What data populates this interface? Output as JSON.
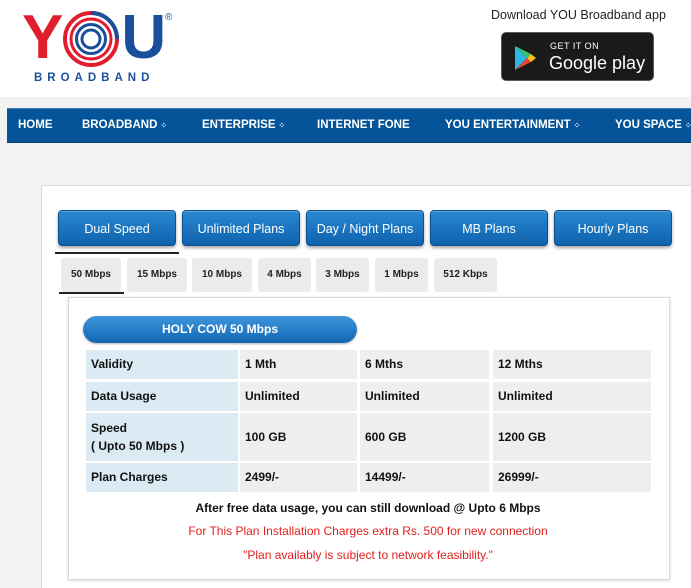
{
  "brand": {
    "logo_text": "YOU",
    "logo_subtitle": "BROADBAND",
    "registered_mark": "®"
  },
  "app_promo": {
    "text": "Download YOU Broadband app",
    "store_small": "GET IT ON",
    "store_big": "Google play"
  },
  "nav": {
    "items": [
      {
        "label": "HOME",
        "dropdown": false
      },
      {
        "label": "BROADBAND",
        "dropdown": true
      },
      {
        "label": "ENTERPRISE",
        "dropdown": true
      },
      {
        "label": "INTERNET FONE",
        "dropdown": false
      },
      {
        "label": "YOU ENTERTAINMENT",
        "dropdown": true
      },
      {
        "label": "YOU SPACE",
        "dropdown": true
      }
    ],
    "dropdown_glyph": "⁘"
  },
  "categories": {
    "items": [
      "Dual Speed",
      "Unlimited Plans",
      "Day / Night Plans",
      "MB Plans",
      "Hourly Plans"
    ],
    "selected": "Dual Speed"
  },
  "speed_tabs": {
    "items": [
      "50 Mbps",
      "15 Mbps",
      "10 Mbps",
      "4 Mbps",
      "3 Mbps",
      "1 Mbps",
      "512 Kbps"
    ],
    "selected": "50 Mbps"
  },
  "plan": {
    "title": "HOLY COW 50 Mbps",
    "table": {
      "rows": [
        {
          "label": "Validity",
          "values": [
            "1 Mth",
            "6 Mths",
            "12 Mths"
          ]
        },
        {
          "label": "Data Usage",
          "values": [
            "Unlimited",
            "Unlimited",
            "Unlimited"
          ]
        },
        {
          "label_line1": "Speed",
          "label_line2": "( Upto 50 Mbps )",
          "values": [
            "100 GB",
            "600 GB",
            "1200 GB"
          ]
        },
        {
          "label": "Plan Charges",
          "values": [
            "2499/-",
            "14499/-",
            "26999/-"
          ]
        }
      ]
    },
    "note_main": "After free data usage, you can still download @ Upto 6 Mbps",
    "note_install": "For This Plan Installation Charges extra Rs. 500 for new connection",
    "note_feasibility": "\"Plan availably is subject to network feasibility.\""
  },
  "colors": {
    "nav_bg": "#05549a",
    "accent_blue": "#1167b3",
    "logo_red": "#e01e2d",
    "logo_blue": "#1a4f9c",
    "label_cell": "#dbeaf3",
    "value_cell": "#eeeeee",
    "warning_text": "#e0201c"
  },
  "icons": [
    "you-logo-o-icon",
    "google-play-icon",
    "dropdown-dots-icon"
  ]
}
